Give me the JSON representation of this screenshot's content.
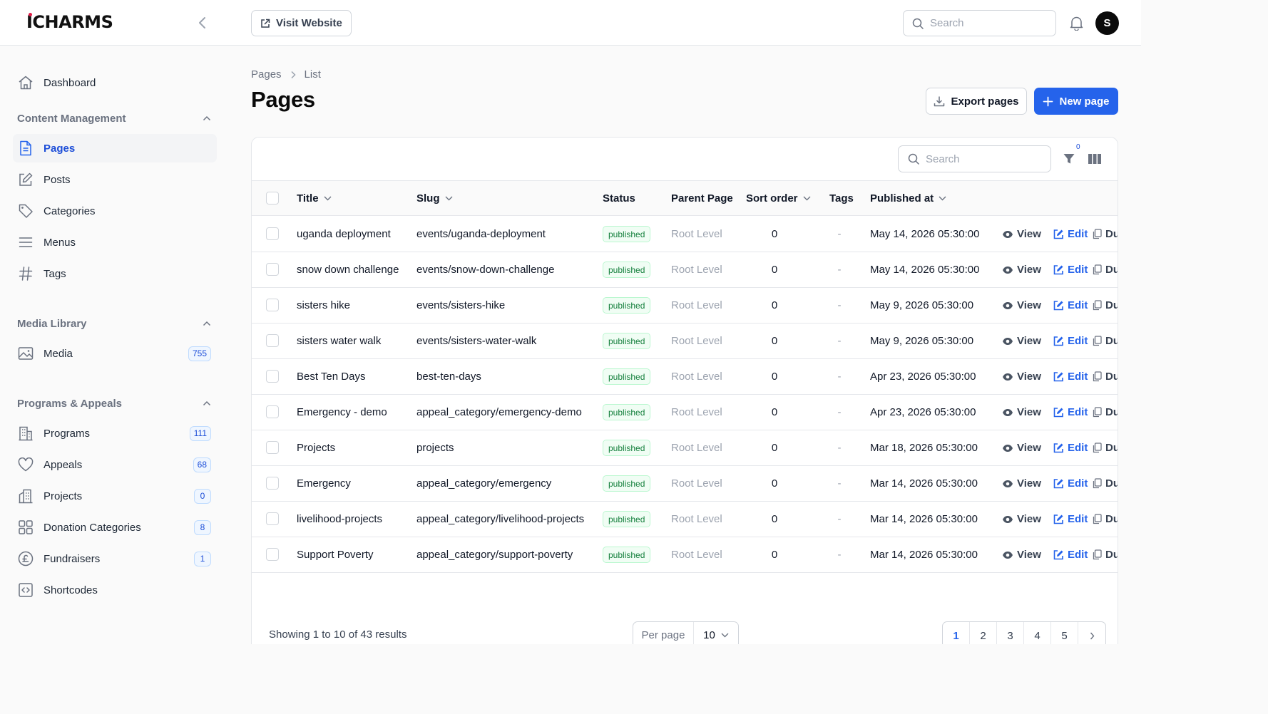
{
  "topbar": {
    "logo": "ICHARMS",
    "visit_website": "Visit Website",
    "search_placeholder": "Search",
    "avatar_initial": "S"
  },
  "sidebar": {
    "dashboard": "Dashboard",
    "groups": {
      "content": "Content Management",
      "media": "Media Library",
      "programs": "Programs & Appeals"
    },
    "items": {
      "pages": "Pages",
      "posts": "Posts",
      "categories": "Categories",
      "menus": "Menus",
      "tags": "Tags",
      "media": "Media",
      "programs": "Programs",
      "appeals": "Appeals",
      "projects": "Projects",
      "donation_categories": "Donation Categories",
      "fundraisers": "Fundraisers",
      "shortcodes": "Shortcodes"
    },
    "badges": {
      "media": "755",
      "programs": "111",
      "appeals": "68",
      "projects": "0",
      "donation_categories": "8",
      "fundraisers": "1"
    }
  },
  "breadcrumb": {
    "parent": "Pages",
    "current": "List"
  },
  "page_title": "Pages",
  "buttons": {
    "export": "Export pages",
    "new": "New page"
  },
  "table": {
    "search_placeholder": "Search",
    "filter_count": "0",
    "columns": {
      "title": "Title",
      "slug": "Slug",
      "status": "Status",
      "parent": "Parent Page",
      "sort": "Sort order",
      "tags": "Tags",
      "published": "Published at"
    },
    "actions": {
      "view": "View",
      "edit": "Edit",
      "dup": "Dup"
    },
    "rows": [
      {
        "title": "uganda deployment",
        "slug": "events/uganda-deployment",
        "status": "published",
        "parent": "Root Level",
        "sort": "0",
        "tags": "-",
        "published": "May 14, 2026 05:30:00"
      },
      {
        "title": "snow down challenge",
        "slug": "events/snow-down-challenge",
        "status": "published",
        "parent": "Root Level",
        "sort": "0",
        "tags": "-",
        "published": "May 14, 2026 05:30:00"
      },
      {
        "title": "sisters hike",
        "slug": "events/sisters-hike",
        "status": "published",
        "parent": "Root Level",
        "sort": "0",
        "tags": "-",
        "published": "May 9, 2026 05:30:00"
      },
      {
        "title": "sisters water walk",
        "slug": "events/sisters-water-walk",
        "status": "published",
        "parent": "Root Level",
        "sort": "0",
        "tags": "-",
        "published": "May 9, 2026 05:30:00"
      },
      {
        "title": "Best Ten Days",
        "slug": "best-ten-days",
        "status": "published",
        "parent": "Root Level",
        "sort": "0",
        "tags": "-",
        "published": "Apr 23, 2026 05:30:00"
      },
      {
        "title": "Emergency - demo",
        "slug": "appeal_category/emergency-demo",
        "status": "published",
        "parent": "Root Level",
        "sort": "0",
        "tags": "-",
        "published": "Apr 23, 2026 05:30:00"
      },
      {
        "title": "Projects",
        "slug": "projects",
        "status": "published",
        "parent": "Root Level",
        "sort": "0",
        "tags": "-",
        "published": "Mar 18, 2026 05:30:00"
      },
      {
        "title": "Emergency",
        "slug": "appeal_category/emergency",
        "status": "published",
        "parent": "Root Level",
        "sort": "0",
        "tags": "-",
        "published": "Mar 14, 2026 05:30:00"
      },
      {
        "title": "livelihood-projects",
        "slug": "appeal_category/livelihood-projects",
        "status": "published",
        "parent": "Root Level",
        "sort": "0",
        "tags": "-",
        "published": "Mar 14, 2026 05:30:00"
      },
      {
        "title": "Support Poverty",
        "slug": "appeal_category/support-poverty",
        "status": "published",
        "parent": "Root Level",
        "sort": "0",
        "tags": "-",
        "published": "Mar 14, 2026 05:30:00"
      }
    ]
  },
  "footer": {
    "showing": "Showing 1 to 10 of 43 results",
    "per_page_label": "Per page",
    "per_page_value": "10",
    "pages": [
      "1",
      "2",
      "3",
      "4",
      "5"
    ]
  }
}
